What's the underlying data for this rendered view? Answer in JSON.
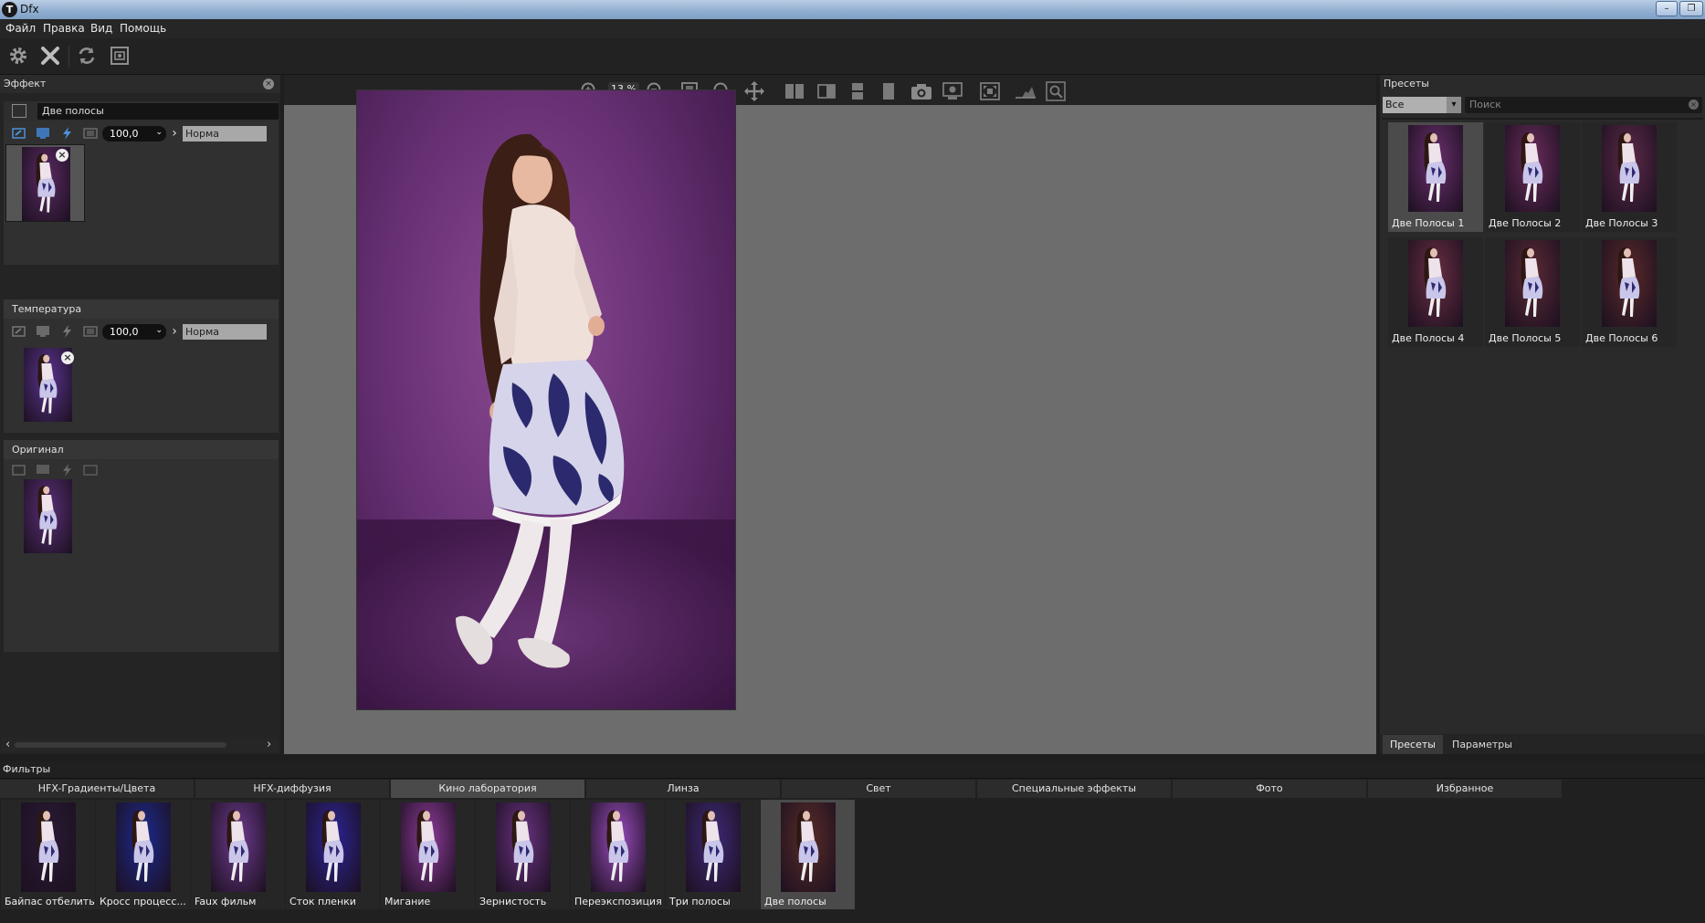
{
  "window": {
    "title": "Dfx",
    "app_icon_glyph": "T"
  },
  "menu": {
    "items": [
      "Файл",
      "Правка",
      "Вид",
      "Помощь"
    ]
  },
  "toolbar": {
    "icons": [
      "gear-icon",
      "close-icon",
      "refresh-icon",
      "screenshot-icon"
    ]
  },
  "effect_panel": {
    "title": "Эффект",
    "layers": [
      {
        "name": "Две полосы",
        "opacity": "100,0",
        "blend": "Норма",
        "tint": "#5b2a63"
      },
      {
        "name": "Температура",
        "opacity": "100,0",
        "blend": "Норма",
        "tint": "#5a3390"
      },
      {
        "name": "Оригинал",
        "tint": "#5a2f78"
      }
    ]
  },
  "viewer": {
    "zoom": "13 %",
    "toolbar_icons": [
      "zoom-in-icon",
      "zoom-out-icon",
      "fit-icon",
      "magnifier-icon",
      "pan-icon",
      "split-vertical-icon",
      "split-horizontal-icon",
      "split-stacked-icon",
      "single-view-icon",
      "camera-icon",
      "snapshot-icon",
      "fullscreen-icon",
      "histogram-icon",
      "loupe-icon"
    ]
  },
  "presets_panel": {
    "title": "Пресеты",
    "category": "Все",
    "search_placeholder": "Поиск",
    "items": [
      {
        "label": "Две Полосы 1",
        "tint": "#6b2f6e"
      },
      {
        "label": "Две Полосы 2",
        "tint": "#6b2c5d"
      },
      {
        "label": "Две Полосы 3",
        "tint": "#5e2a4a"
      },
      {
        "label": "Две Полосы 4",
        "tint": "#6a2e42"
      },
      {
        "label": "Две Полосы 5",
        "tint": "#5c2a35"
      },
      {
        "label": "Две Полосы 6",
        "tint": "#5a2a2a"
      }
    ],
    "tabs": [
      "Пресеты",
      "Параметры"
    ]
  },
  "filters": {
    "title": "Фильтры",
    "tabs": [
      "HFX-Градиенты/Цвета",
      "HFX-диффузия",
      "Кино лаборатория",
      "Линза",
      "Свет",
      "Специальные эффекты",
      "Фото",
      "Избранное"
    ],
    "active_tab": 2,
    "items": [
      {
        "label": "Байпас отбелить",
        "tint": "#2a1a34"
      },
      {
        "label": "Кросс процесс...",
        "tint": "#1b2a8e"
      },
      {
        "label": "Faux фильм",
        "tint": "#6e3a8e"
      },
      {
        "label": "Сток пленки",
        "tint": "#2b2498"
      },
      {
        "label": "Мигание",
        "tint": "#8e3a9a"
      },
      {
        "label": "Зернистость",
        "tint": "#6a3282"
      },
      {
        "label": "Переэкспозиция",
        "tint": "#9a4cbe"
      },
      {
        "label": "Три полосы",
        "tint": "#3e2a78"
      },
      {
        "label": "Две полосы",
        "tint": "#5a2c28"
      }
    ],
    "selected_index": 8
  },
  "colors": {
    "background": "#1e1e1e",
    "viewer_background": "#6d6d6d",
    "photo_backdrop": "#6a3276",
    "selection": "#4a4a4a"
  }
}
